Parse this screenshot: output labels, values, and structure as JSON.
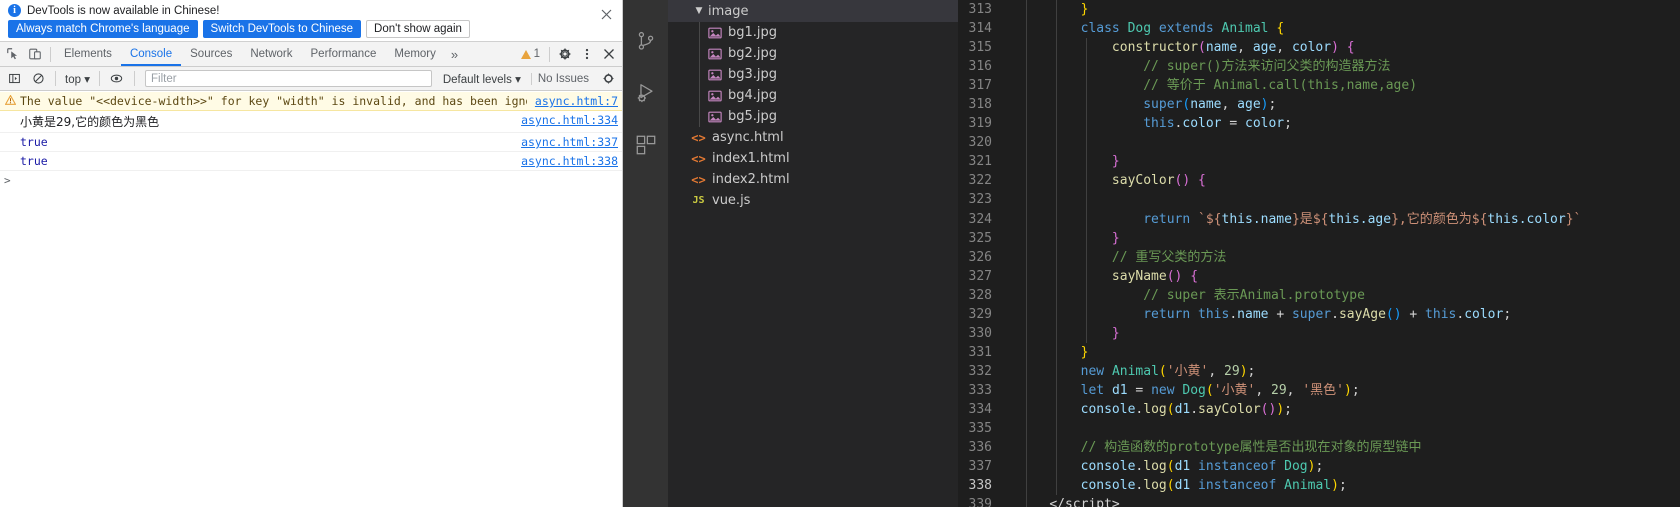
{
  "devtools": {
    "infobar": {
      "icon": "info-icon",
      "message": "DevTools is now available in Chinese!",
      "buttons": [
        {
          "label": "Always match Chrome's language",
          "style": "primary",
          "name": "always-match-language-button"
        },
        {
          "label": "Switch DevTools to Chinese",
          "style": "primary",
          "name": "switch-to-chinese-button"
        },
        {
          "label": "Don't show again",
          "style": "plain",
          "name": "dont-show-again-button"
        }
      ],
      "close_icon": "close-icon"
    },
    "toolbar": {
      "inspect_icon": "inspect-element-icon",
      "device_icon": "device-toolbar-icon",
      "tabs": [
        {
          "label": "Elements",
          "active": false
        },
        {
          "label": "Console",
          "active": true
        },
        {
          "label": "Sources",
          "active": false
        },
        {
          "label": "Network",
          "active": false
        },
        {
          "label": "Performance",
          "active": false
        },
        {
          "label": "Memory",
          "active": false
        }
      ],
      "more_tabs_icon": "chevron-double-right-icon",
      "warning_count": "1",
      "warning_icon": "warning-triangle-icon",
      "settings_icon": "gear-icon",
      "menu_icon": "kebab-menu-icon",
      "close_icon": "close-icon"
    },
    "console_toolbar": {
      "sidebar_icon": "console-sidebar-icon",
      "clear_icon": "clear-console-icon",
      "context": "top",
      "context_chevron": "chevron-down-icon",
      "eye_icon": "live-expression-icon",
      "filter_placeholder": "Filter",
      "filter_value": "",
      "levels": "Default levels",
      "levels_chevron": "chevron-down-icon",
      "issues": "No Issues",
      "settings_icon": "gear-icon"
    },
    "messages": [
      {
        "type": "warning",
        "icon": "warning-triangle-icon",
        "text": "The value \"<<device-width>>\" for key \"width\" is invalid, and has been ignored.",
        "source": "async.html:7"
      },
      {
        "type": "log",
        "text": "小黄是29,它的颜色为黑色",
        "source": "async.html:334"
      },
      {
        "type": "log",
        "text": "true",
        "source": "async.html:337"
      },
      {
        "type": "log",
        "text": "true",
        "source": "async.html:338"
      }
    ],
    "prompt": ">"
  },
  "vscode": {
    "activity_bar": [
      {
        "name": "source-control-icon"
      },
      {
        "name": "run-and-debug-icon"
      },
      {
        "name": "extensions-icon"
      }
    ],
    "explorer": {
      "folder": {
        "label": "image",
        "chevron": "chevron-down-icon",
        "expanded": true
      },
      "files": [
        {
          "label": "bg1.jpg",
          "icon": "image-file-icon",
          "nested": true
        },
        {
          "label": "bg2.jpg",
          "icon": "image-file-icon",
          "nested": true
        },
        {
          "label": "bg3.jpg",
          "icon": "image-file-icon",
          "nested": true
        },
        {
          "label": "bg4.jpg",
          "icon": "image-file-icon",
          "nested": true
        },
        {
          "label": "bg5.jpg",
          "icon": "image-file-icon",
          "nested": true
        },
        {
          "label": "async.html",
          "icon": "html-file-icon",
          "nested": false
        },
        {
          "label": "index1.html",
          "icon": "html-file-icon",
          "nested": false
        },
        {
          "label": "index2.html",
          "icon": "html-file-icon",
          "nested": false
        },
        {
          "label": "vue.js",
          "icon": "js-file-icon",
          "nested": false
        }
      ]
    },
    "editor": {
      "first_line": 313,
      "current_line": 338,
      "lines": [
        {
          "n": 313,
          "html": "<span class='g1'></span><span class='g2'></span>        <span class='p1'>}</span>"
        },
        {
          "n": 314,
          "html": "<span class='g1'></span><span class='g2'></span>        <span class='kw'>class</span> <span class='cls'>Dog</span> <span class='kw'>extends</span> <span class='cls'>Animal</span> <span class='p1'>{</span>"
        },
        {
          "n": 315,
          "html": "<span class='g1'></span><span class='g2'></span><span class='g3'></span>            <span class='fn'>constructor</span><span class='p2'>(</span><span class='var'>name</span>, <span class='var'>age</span>, <span class='var'>color</span><span class='p2'>)</span> <span class='p2'>{</span>"
        },
        {
          "n": 316,
          "html": "<span class='g1'></span><span class='g2'></span><span class='g3'></span>                <span class='cmt'>// super()方法来访问父类的构造器方法</span>"
        },
        {
          "n": 317,
          "html": "<span class='g1'></span><span class='g2'></span><span class='g3'></span>                <span class='cmt'>// 等价于 Animal.call(this,name,age)</span>"
        },
        {
          "n": 318,
          "html": "<span class='g1'></span><span class='g2'></span><span class='g3'></span>                <span class='kw'>super</span><span class='p3'>(</span><span class='var'>name</span>, <span class='var'>age</span><span class='p3'>)</span>;"
        },
        {
          "n": 319,
          "html": "<span class='g1'></span><span class='g2'></span><span class='g3'></span>                <span class='kw'>this</span>.<span class='var'>color</span> <span class='op'>=</span> <span class='var'>color</span>;"
        },
        {
          "n": 320,
          "html": "<span class='g1'></span><span class='g2'></span><span class='g3'></span>"
        },
        {
          "n": 321,
          "html": "<span class='g1'></span><span class='g2'></span><span class='g3'></span>            <span class='p2'>}</span>"
        },
        {
          "n": 322,
          "html": "<span class='g1'></span><span class='g2'></span><span class='g3'></span>            <span class='fn'>sayColor</span><span class='p2'>()</span> <span class='p2'>{</span>"
        },
        {
          "n": 323,
          "html": "<span class='g1'></span><span class='g2'></span><span class='g3'></span>"
        },
        {
          "n": 324,
          "html": "<span class='g1'></span><span class='g2'></span><span class='g3'></span>                <span class='kw'>return</span> <span class='tpl'>`</span><span class='tpl'>${</span><span class='var'>this.name</span><span class='tpl'>}</span><span class='str'>是</span><span class='tpl'>${</span><span class='var'>this.age</span><span class='tpl'>}</span><span class='str'>,它的颜色为</span><span class='tpl'>${</span><span class='var'>this.color</span><span class='tpl'>}`</span>"
        },
        {
          "n": 325,
          "html": "<span class='g1'></span><span class='g2'></span><span class='g3'></span>            <span class='p2'>}</span>"
        },
        {
          "n": 326,
          "html": "<span class='g1'></span><span class='g2'></span><span class='g3'></span>            <span class='cmt'>// 重写父类的方法</span>"
        },
        {
          "n": 327,
          "html": "<span class='g1'></span><span class='g2'></span><span class='g3'></span>            <span class='fn'>sayName</span><span class='p2'>()</span> <span class='p2'>{</span>"
        },
        {
          "n": 328,
          "html": "<span class='g1'></span><span class='g2'></span><span class='g3'></span>                <span class='cmt'>// super 表示Animal.prototype</span>"
        },
        {
          "n": 329,
          "html": "<span class='g1'></span><span class='g2'></span><span class='g3'></span>                <span class='kw'>return</span> <span class='kw'>this</span>.<span class='var'>name</span> <span class='op'>+</span> <span class='kw'>super</span>.<span class='fn'>sayAge</span><span class='p3'>()</span> <span class='op'>+</span> <span class='kw'>this</span>.<span class='var'>color</span>;"
        },
        {
          "n": 330,
          "html": "<span class='g1'></span><span class='g2'></span><span class='g3'></span>            <span class='p2'>}</span>"
        },
        {
          "n": 331,
          "html": "<span class='g1'></span><span class='g2'></span>        <span class='p1'>}</span>"
        },
        {
          "n": 332,
          "html": "<span class='g1'></span><span class='g2'></span>        <span class='kw'>new</span> <span class='cls'>Animal</span><span class='p1'>(</span><span class='str'>'小黄'</span>, <span class='num'>29</span><span class='p1'>)</span>;"
        },
        {
          "n": 333,
          "html": "<span class='g1'></span><span class='g2'></span>        <span class='kw'>let</span> <span class='var'>d1</span> <span class='op'>=</span> <span class='kw'>new</span> <span class='cls'>Dog</span><span class='p1'>(</span><span class='str'>'小黄'</span>, <span class='num'>29</span>, <span class='str'>'黑色'</span><span class='p1'>)</span>;"
        },
        {
          "n": 334,
          "html": "<span class='g1'></span><span class='g2'></span>        <span class='var'>console</span>.<span class='fn'>log</span><span class='p1'>(</span><span class='var'>d1</span>.<span class='fn'>sayColor</span><span class='p2'>()</span><span class='p1'>)</span>;"
        },
        {
          "n": 335,
          "html": "<span class='g1'></span><span class='g2'></span>"
        },
        {
          "n": 336,
          "html": "<span class='g1'></span><span class='g2'></span>        <span class='cmt'>// 构造函数的prototype属性是否出现在对象的原型链中</span>"
        },
        {
          "n": 337,
          "html": "<span class='g1'></span><span class='g2'></span>        <span class='var'>console</span>.<span class='fn'>log</span><span class='p1'>(</span><span class='var'>d1</span> <span class='kw'>instanceof</span> <span class='cls'>Dog</span><span class='p1'>)</span>;"
        },
        {
          "n": 338,
          "html": "<span class='g1'></span><span class='g2'></span>        <span class='var'>console</span>.<span class='fn'>log</span><span class='p1'>(</span><span class='var'>d1</span> <span class='kw'>instanceof</span> <span class='cls'>Animal</span><span class='p1'>)</span>;"
        },
        {
          "n": 339,
          "html": "<span class='g1'></span>    <span class='op'>&lt;/script&gt;</span>"
        }
      ]
    }
  },
  "colors": {
    "chrome_blue": "#1a73e8",
    "warning_bg": "#fffbe5",
    "vscode_editor_bg": "#1e1e1e",
    "vscode_sidebar_bg": "#252526",
    "vscode_activitybar_bg": "#333333"
  }
}
